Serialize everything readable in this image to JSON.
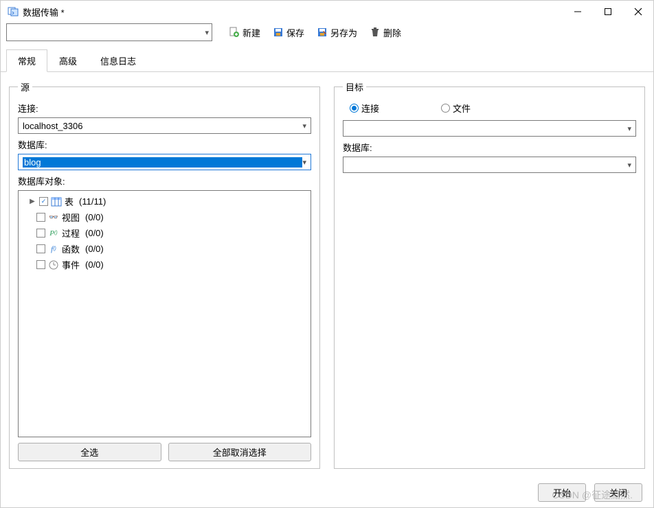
{
  "window": {
    "title": "数据传输 *"
  },
  "toolbar": {
    "new": "新建",
    "save": "保存",
    "saveAs": "另存为",
    "delete": "删除"
  },
  "tabs": {
    "general": "常规",
    "advanced": "高级",
    "log": "信息日志"
  },
  "source": {
    "legend": "源",
    "connectionLabel": "连接:",
    "connectionValue": "localhost_3306",
    "databaseLabel": "数据库:",
    "databaseValue": "blog",
    "objectsLabel": "数据库对象:",
    "tree": {
      "tables": {
        "label": "表",
        "count": "(11/11)"
      },
      "views": {
        "label": "视图",
        "count": "(0/0)"
      },
      "procs": {
        "label": "过程",
        "count": "(0/0)"
      },
      "funcs": {
        "label": "函数",
        "count": "(0/0)"
      },
      "events": {
        "label": "事件",
        "count": "(0/0)"
      }
    },
    "selectAll": "全选",
    "deselectAll": "全部取消选择"
  },
  "target": {
    "legend": "目标",
    "radioConnection": "连接",
    "radioFile": "文件",
    "databaseLabel": "数据库:"
  },
  "footer": {
    "start": "开始",
    "close": "关闭"
  },
  "watermark": "CSDN @征途黯然."
}
